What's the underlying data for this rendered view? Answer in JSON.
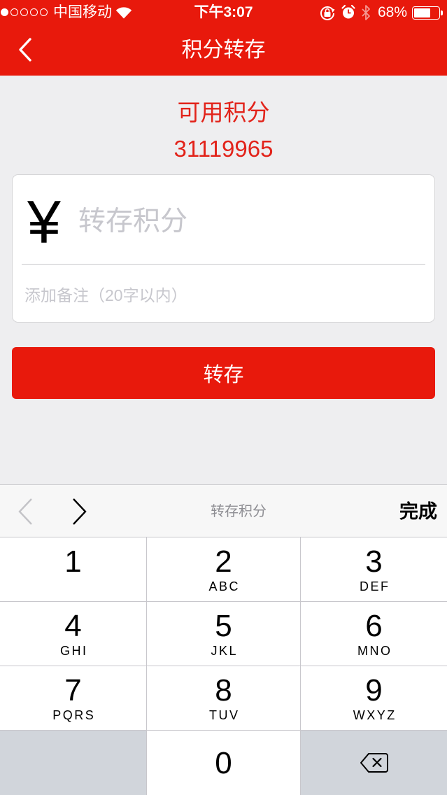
{
  "status_bar": {
    "signal_level": 1,
    "signal_max": 5,
    "carrier": "中国移动",
    "time": "下午3:07",
    "battery_text": "68%",
    "battery_level": 0.68,
    "icons": [
      "signal-dots-icon",
      "wifi-icon",
      "rotation-lock-icon",
      "alarm-icon",
      "bluetooth-icon",
      "battery-icon"
    ]
  },
  "nav": {
    "back_icon": "chevron-left-icon",
    "title": "积分转存"
  },
  "points": {
    "label": "可用积分",
    "value": "31119965"
  },
  "form": {
    "currency_symbol": "¥",
    "amount_placeholder": "转存积分",
    "note_placeholder": "添加备注（20字以内）"
  },
  "submit": {
    "label": "转存"
  },
  "keyboard": {
    "toolbar": {
      "prev_icon": "chevron-left-icon",
      "next_icon": "chevron-right-icon",
      "field_label": "转存积分",
      "done_label": "完成"
    },
    "keys": [
      {
        "digit": "1"
      },
      {
        "digit": "2",
        "letters": "ABC"
      },
      {
        "digit": "3",
        "letters": "DEF"
      },
      {
        "digit": "4",
        "letters": "GHI"
      },
      {
        "digit": "5",
        "letters": "JKL"
      },
      {
        "digit": "6",
        "letters": "MNO"
      },
      {
        "digit": "7",
        "letters": "PQRS"
      },
      {
        "digit": "8",
        "letters": "TUV"
      },
      {
        "digit": "9",
        "letters": "WXYZ"
      },
      {
        "digit": "0"
      }
    ],
    "delete_icon": "backspace-icon"
  },
  "colors": {
    "brand_red": "#e8190c",
    "points_red": "#e2231a",
    "page_bg": "#eeeef0",
    "placeholder": "#c7c7cd",
    "key_separator": "#c8c7cc",
    "key_dark": "#d1d5db",
    "toolbar_bg": "#f7f7f7"
  }
}
